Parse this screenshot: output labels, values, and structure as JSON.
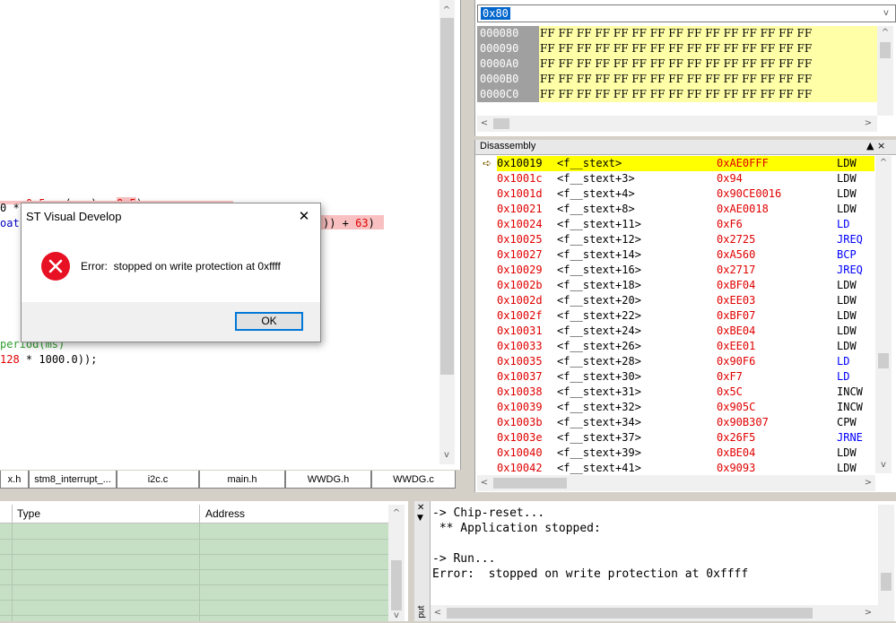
{
  "editor": {
    "lines": [
      {
        "text": "0.5 : (num) + 0.5)"
      },
      {
        "text": "0 *"
      },
      {
        "text": "oat"
      },
      {
        "text": ")) + 63)"
      },
      {
        "text": "period(ms)"
      },
      {
        "text": "128 * 1000.0));"
      }
    ],
    "tabs": [
      "x.h",
      "stm8_interrupt_...",
      "i2c.c",
      "main.h",
      "WWDG.h",
      "WWDG.c"
    ]
  },
  "memory": {
    "address_input": "0x80",
    "rows": [
      {
        "addr": "000080",
        "bytes": "FF FF FF FF FF FF FF FF FF FF FF FF FF FF FF"
      },
      {
        "addr": "000090",
        "bytes": "FF FF FF FF FF FF FF FF FF FF FF FF FF FF FF"
      },
      {
        "addr": "0000A0",
        "bytes": "FF FF FF FF FF FF FF FF FF FF FF FF FF FF FF"
      },
      {
        "addr": "0000B0",
        "bytes": "FF FF FF FF FF FF FF FF FF FF FF FF FF FF FF"
      },
      {
        "addr": "0000C0",
        "bytes": "FF FF FF FF FF FF FF FF FF FF FF FF FF FF FF"
      }
    ]
  },
  "disassembly": {
    "title": "Disassembly",
    "controls": "▲ ×",
    "rows": [
      {
        "addr": "0x10019",
        "sym": "<f__stext>",
        "op": "0xAE0FFF",
        "mn": "LDW",
        "kind": "normal"
      },
      {
        "addr": "0x1001c",
        "sym": "<f__stext+3>",
        "op": "0x94",
        "mn": "LDW",
        "kind": "normal"
      },
      {
        "addr": "0x1001d",
        "sym": "<f__stext+4>",
        "op": "0x90CE0016",
        "mn": "LDW",
        "kind": "normal"
      },
      {
        "addr": "0x10021",
        "sym": "<f__stext+8>",
        "op": "0xAE0018",
        "mn": "LDW",
        "kind": "normal"
      },
      {
        "addr": "0x10024",
        "sym": "<f__stext+11>",
        "op": "0xF6",
        "mn": "LD",
        "kind": "load"
      },
      {
        "addr": "0x10025",
        "sym": "<f__stext+12>",
        "op": "0x2725",
        "mn": "JREQ",
        "kind": "jump"
      },
      {
        "addr": "0x10027",
        "sym": "<f__stext+14>",
        "op": "0xA560",
        "mn": "BCP",
        "kind": "jump"
      },
      {
        "addr": "0x10029",
        "sym": "<f__stext+16>",
        "op": "0x2717",
        "mn": "JREQ",
        "kind": "jump"
      },
      {
        "addr": "0x1002b",
        "sym": "<f__stext+18>",
        "op": "0xBF04",
        "mn": "LDW",
        "kind": "normal"
      },
      {
        "addr": "0x1002d",
        "sym": "<f__stext+20>",
        "op": "0xEE03",
        "mn": "LDW",
        "kind": "normal"
      },
      {
        "addr": "0x1002f",
        "sym": "<f__stext+22>",
        "op": "0xBF07",
        "mn": "LDW",
        "kind": "normal"
      },
      {
        "addr": "0x10031",
        "sym": "<f__stext+24>",
        "op": "0xBE04",
        "mn": "LDW",
        "kind": "normal"
      },
      {
        "addr": "0x10033",
        "sym": "<f__stext+26>",
        "op": "0xEE01",
        "mn": "LDW",
        "kind": "normal"
      },
      {
        "addr": "0x10035",
        "sym": "<f__stext+28>",
        "op": "0x90F6",
        "mn": "LD",
        "kind": "load"
      },
      {
        "addr": "0x10037",
        "sym": "<f__stext+30>",
        "op": "0xF7",
        "mn": "LD",
        "kind": "load"
      },
      {
        "addr": "0x10038",
        "sym": "<f__stext+31>",
        "op": "0x5C",
        "mn": "INCW",
        "kind": "normal"
      },
      {
        "addr": "0x10039",
        "sym": "<f__stext+32>",
        "op": "0x905C",
        "mn": "INCW",
        "kind": "normal"
      },
      {
        "addr": "0x1003b",
        "sym": "<f__stext+34>",
        "op": "0x90B307",
        "mn": "CPW",
        "kind": "normal"
      },
      {
        "addr": "0x1003e",
        "sym": "<f__stext+37>",
        "op": "0x26F5",
        "mn": "JRNE",
        "kind": "jump"
      },
      {
        "addr": "0x10040",
        "sym": "<f__stext+39>",
        "op": "0xBE04",
        "mn": "LDW",
        "kind": "normal"
      },
      {
        "addr": "0x10042",
        "sym": "<f__stext+41>",
        "op": "0x9093",
        "mn": "LDW",
        "kind": "normal"
      }
    ]
  },
  "watch": {
    "columns": [
      "Type",
      "Address"
    ]
  },
  "output": {
    "side_label": "put",
    "lines": [
      "-> Chip-reset...",
      " ** Application stopped:",
      "",
      "-> Run...",
      "Error:  stopped on write protection at 0xffff"
    ]
  },
  "dialog": {
    "title": "ST Visual Develop",
    "message": "Error:  stopped on write protection at 0xffff",
    "ok_label": "OK",
    "close_glyph": "✕"
  },
  "colors": {
    "highlight_yellow": "#ffff00",
    "mem_yellow": "#ffffa8",
    "addr_red": "#e00000",
    "jump_blue": "#0000ff",
    "watch_green": "#c6e0c6",
    "error_red": "#e81123"
  }
}
